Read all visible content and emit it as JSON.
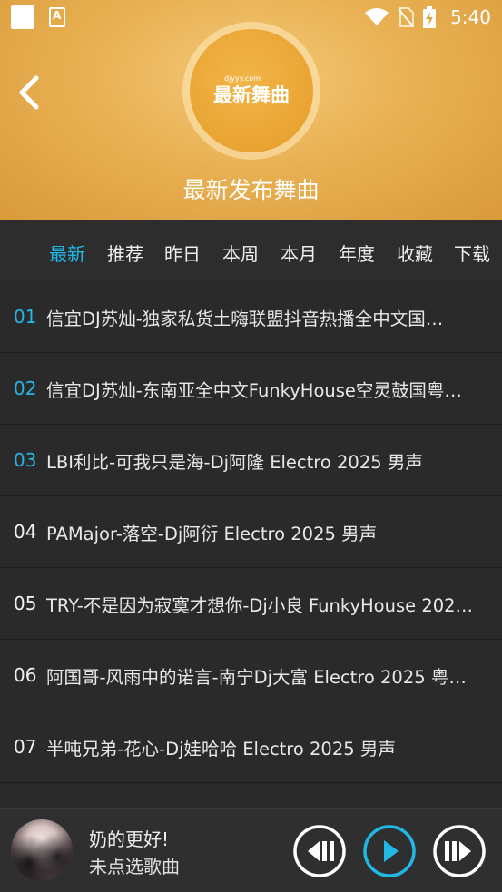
{
  "status_bar": {
    "time": "5:40"
  },
  "header": {
    "disc_small_text": "djyyy.com",
    "disc_title": "最新舞曲",
    "title": "最新发布舞曲"
  },
  "tabs": [
    {
      "label": "最新",
      "active": true
    },
    {
      "label": "推荐",
      "active": false
    },
    {
      "label": "昨日",
      "active": false
    },
    {
      "label": "本周",
      "active": false
    },
    {
      "label": "本月",
      "active": false
    },
    {
      "label": "年度",
      "active": false
    },
    {
      "label": "收藏",
      "active": false
    },
    {
      "label": "下载",
      "active": false
    }
  ],
  "songs": [
    {
      "num": "01",
      "title": "信宜DJ苏灿-独家私货土嗨联盟抖音热播全中文国…",
      "highlight": true
    },
    {
      "num": "02",
      "title": "信宜DJ苏灿-东南亚全中文FunkyHouse空灵鼓国粤…",
      "highlight": true
    },
    {
      "num": "03",
      "title": "LBI利比-可我只是海-Dj阿隆 Electro 2025 男声",
      "highlight": true
    },
    {
      "num": "04",
      "title": "PAMajor-落空-Dj阿衍 Electro 2025 男声",
      "highlight": false
    },
    {
      "num": "05",
      "title": "TRY-不是因为寂寞才想你-Dj小良 FunkyHouse 202…",
      "highlight": false
    },
    {
      "num": "06",
      "title": "阿国哥-风雨中的诺言-南宁Dj大富 Electro 2025 粤…",
      "highlight": false
    },
    {
      "num": "07",
      "title": "半吨兄弟-花心-Dj娃哈哈 Electro 2025 男声",
      "highlight": false
    }
  ],
  "player": {
    "now_title": "奶的更好!",
    "now_sub": "未点选歌曲"
  },
  "colors": {
    "accent": "#21b8e6",
    "header_gold": "#e9b153"
  }
}
